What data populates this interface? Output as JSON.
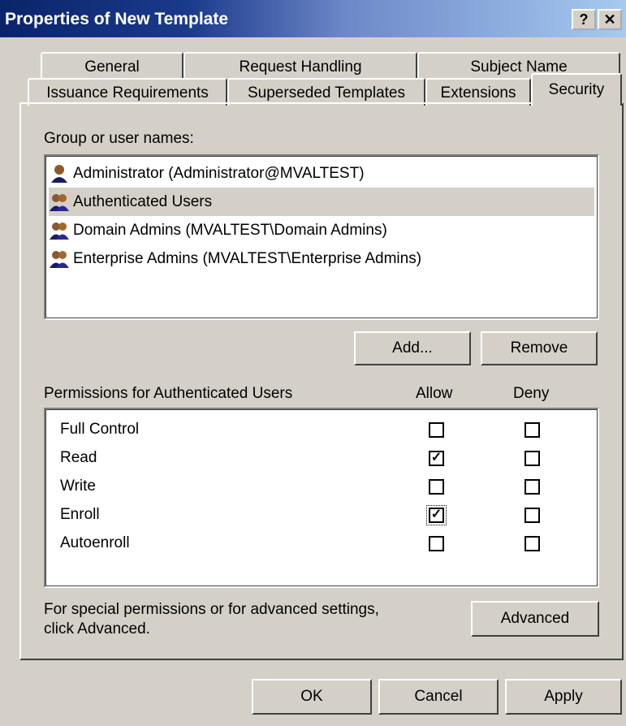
{
  "window": {
    "title": "Properties of New Template",
    "help_label": "?",
    "close_label": "✕"
  },
  "tabs": {
    "row1": [
      "General",
      "Request Handling",
      "Subject Name"
    ],
    "row2": [
      "Issuance Requirements",
      "Superseded Templates",
      "Extensions",
      "Security"
    ],
    "active": "Security"
  },
  "security": {
    "group_label": "Group or user names:",
    "users": [
      {
        "name": "Administrator (Administrator@MVALTEST)",
        "icon": "user-icon",
        "selected": false
      },
      {
        "name": "Authenticated Users",
        "icon": "group-icon",
        "selected": true
      },
      {
        "name": "Domain Admins (MVALTEST\\Domain Admins)",
        "icon": "group-icon",
        "selected": false
      },
      {
        "name": "Enterprise Admins (MVALTEST\\Enterprise Admins)",
        "icon": "group-icon",
        "selected": false
      }
    ],
    "add_label": "Add...",
    "remove_label": "Remove",
    "permissions_label": "Permissions for Authenticated Users",
    "allow_header": "Allow",
    "deny_header": "Deny",
    "permissions": [
      {
        "name": "Full Control",
        "allow": false,
        "deny": false
      },
      {
        "name": "Read",
        "allow": true,
        "deny": false
      },
      {
        "name": "Write",
        "allow": false,
        "deny": false
      },
      {
        "name": "Enroll",
        "allow": true,
        "deny": false
      },
      {
        "name": "Autoenroll",
        "allow": false,
        "deny": false
      }
    ],
    "advanced_text_line1": "For special permissions or for advanced settings,",
    "advanced_text_line2": "click Advanced.",
    "advanced_label": "Advanced"
  },
  "footer": {
    "ok_label": "OK",
    "cancel_label": "Cancel",
    "apply_label": "Apply"
  },
  "colors": {
    "title_bar_start": "#0a246a",
    "dialog_face": "#d4d0c8"
  }
}
